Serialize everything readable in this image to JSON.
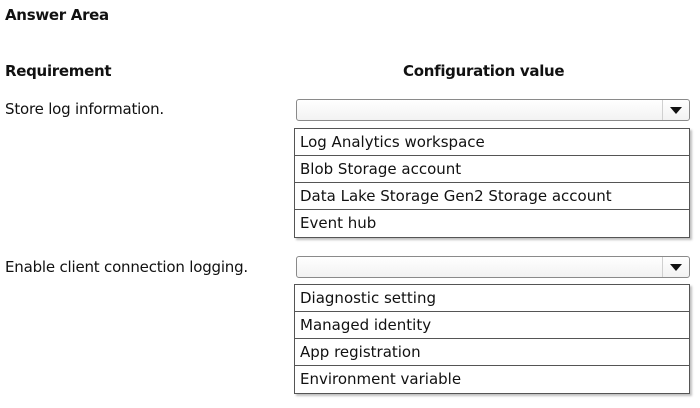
{
  "title": "Answer Area",
  "headers": {
    "requirement": "Requirement",
    "configuration_value": "Configuration value"
  },
  "requirements": [
    {
      "label": "Store log information.",
      "selected": "",
      "options": [
        "Log Analytics workspace",
        "Blob Storage account",
        "Data Lake Storage Gen2 Storage account",
        "Event hub"
      ]
    },
    {
      "label": "Enable client connection logging.",
      "selected": "",
      "options": [
        "Diagnostic setting",
        "Managed identity",
        "App registration",
        "Environment variable"
      ]
    }
  ],
  "icons": {
    "dropdown": "caret-down-icon"
  }
}
